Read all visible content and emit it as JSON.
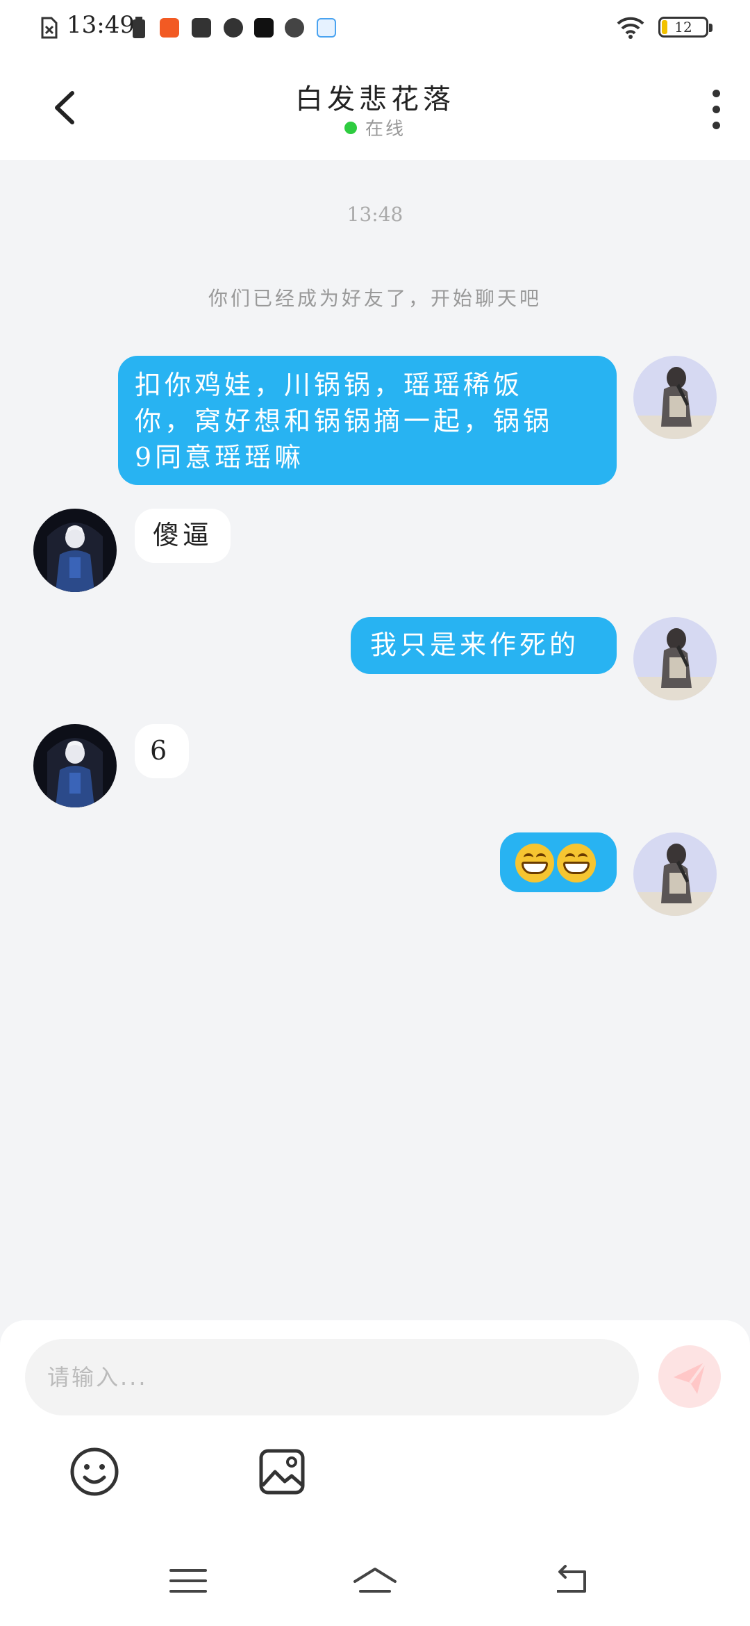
{
  "status_bar": {
    "time": "13:49",
    "battery_level": "12",
    "icons": [
      "file-x-icon",
      "battery-small-icon",
      "app-orange-icon",
      "inbox-icon",
      "play-icon",
      "capcut-icon",
      "speedometer-icon",
      "app-100-icon",
      "wifi-icon"
    ]
  },
  "header": {
    "title": "白发悲花落",
    "status": "在线",
    "status_color": "#2ecc40"
  },
  "chat": {
    "timestamp": "13:48",
    "system_message": "你们已经成为好友了，开始聊天吧",
    "messages": [
      {
        "direction": "outgoing",
        "lines": [
          "扣你鸡娃，川锅锅，瑶瑶稀饭",
          "你，窝好想和锅锅摘一起，锅锅",
          "9同意瑶瑶嘛"
        ]
      },
      {
        "direction": "incoming",
        "text": "傻逼"
      },
      {
        "direction": "outgoing",
        "text": "我只是来作死的"
      },
      {
        "direction": "incoming",
        "text": "6"
      },
      {
        "direction": "outgoing",
        "emoji": [
          "grinning-face",
          "grinning-face"
        ]
      }
    ],
    "outgoing_bubble_color": "#28b3f2",
    "incoming_bubble_color": "#ffffff"
  },
  "input": {
    "placeholder": "请输入..."
  },
  "colors": {
    "background": "#f3f4f6",
    "send_button": "#fde3e3"
  }
}
